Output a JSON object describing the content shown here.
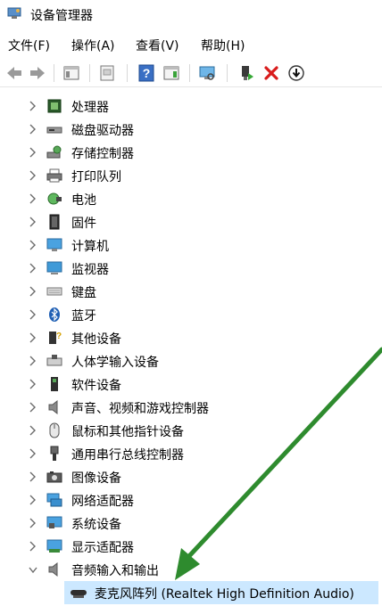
{
  "window": {
    "title": "设备管理器",
    "accent": "#cce8ff"
  },
  "menu": [
    "文件(F)",
    "操作(A)",
    "查看(V)",
    "帮助(H)"
  ],
  "toolbar": [
    "back-icon",
    "forward-icon",
    "properties-icon",
    "update-icon",
    "help-icon",
    "view-icon",
    "scan-icon",
    "enable-device-icon",
    "uninstall-icon",
    "download-icon"
  ],
  "tree": {
    "categories": [
      {
        "label": "处理器",
        "icon": "processor-icon",
        "expanded": false
      },
      {
        "label": "磁盘驱动器",
        "icon": "disk-drive-icon",
        "expanded": false
      },
      {
        "label": "存储控制器",
        "icon": "storage-controller-icon",
        "expanded": false
      },
      {
        "label": "打印队列",
        "icon": "printer-icon",
        "expanded": false
      },
      {
        "label": "电池",
        "icon": "battery-icon",
        "expanded": false
      },
      {
        "label": "固件",
        "icon": "firmware-icon",
        "expanded": false
      },
      {
        "label": "计算机",
        "icon": "computer-icon",
        "expanded": false
      },
      {
        "label": "监视器",
        "icon": "monitor-icon",
        "expanded": false
      },
      {
        "label": "键盘",
        "icon": "keyboard-icon",
        "expanded": false
      },
      {
        "label": "蓝牙",
        "icon": "bluetooth-icon",
        "expanded": false
      },
      {
        "label": "其他设备",
        "icon": "other-device-icon",
        "expanded": false
      },
      {
        "label": "人体学输入设备",
        "icon": "hid-icon",
        "expanded": false
      },
      {
        "label": "软件设备",
        "icon": "software-device-icon",
        "expanded": false
      },
      {
        "label": "声音、视频和游戏控制器",
        "icon": "speaker-icon",
        "expanded": false
      },
      {
        "label": "鼠标和其他指针设备",
        "icon": "mouse-icon",
        "expanded": false
      },
      {
        "label": "通用串行总线控制器",
        "icon": "usb-icon",
        "expanded": false
      },
      {
        "label": "图像设备",
        "icon": "camera-icon",
        "expanded": false
      },
      {
        "label": "网络适配器",
        "icon": "network-icon",
        "expanded": false
      },
      {
        "label": "系统设备",
        "icon": "system-device-icon",
        "expanded": false
      },
      {
        "label": "显示适配器",
        "icon": "display-adapter-icon",
        "expanded": false
      },
      {
        "label": "音频输入和输出",
        "icon": "audio-io-icon",
        "expanded": true
      }
    ],
    "selected_child": {
      "label": "麦克风阵列 (Realtek High Definition Audio)",
      "icon": "microphone-icon"
    }
  },
  "annotation": {
    "arrow_color": "#2e8b2e"
  }
}
